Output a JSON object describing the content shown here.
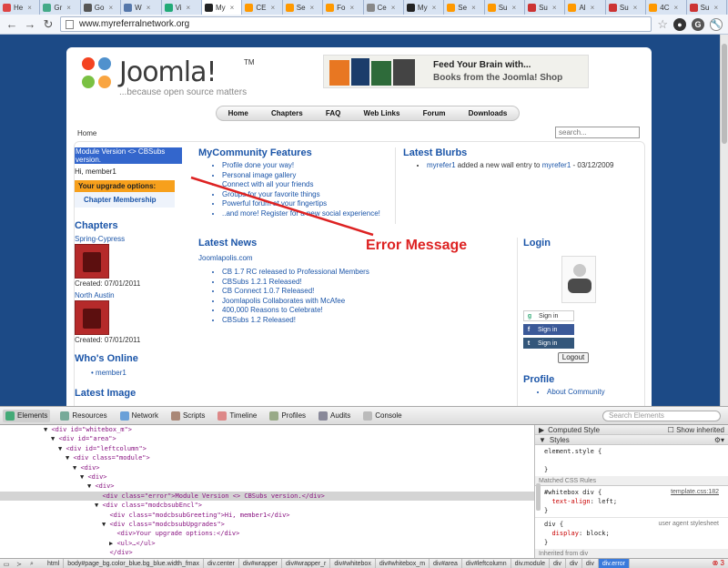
{
  "browser": {
    "tabs": [
      {
        "label": "He",
        "color": "#d44"
      },
      {
        "label": "Gr",
        "color": "#4a8"
      },
      {
        "label": "Go",
        "color": "#555"
      },
      {
        "label": "W",
        "color": "#57a"
      },
      {
        "label": "Vi",
        "color": "#2a7"
      },
      {
        "label": "My",
        "color": "#222",
        "active": true
      },
      {
        "label": "CE",
        "color": "#f90"
      },
      {
        "label": "Se",
        "color": "#f90"
      },
      {
        "label": "Fo",
        "color": "#f90"
      },
      {
        "label": "Ce",
        "color": "#888"
      },
      {
        "label": "My",
        "color": "#222"
      },
      {
        "label": "Se",
        "color": "#f90"
      },
      {
        "label": "Su",
        "color": "#f90"
      },
      {
        "label": "Su",
        "color": "#c33"
      },
      {
        "label": "Al",
        "color": "#f90"
      },
      {
        "label": "Su",
        "color": "#c33"
      },
      {
        "label": "4C",
        "color": "#f90"
      },
      {
        "label": "Su",
        "color": "#c33"
      }
    ],
    "url": "www.myreferralnetwork.org"
  },
  "site": {
    "logo_name": "Joomla!",
    "logo_tm": "TM",
    "logo_tagline": "...because open source matters",
    "banner_line1": "Feed Your Brain with...",
    "banner_line2": "Books from the Joomla! Shop",
    "menu": [
      "Home",
      "Chapters",
      "FAQ",
      "Web Links",
      "Forum",
      "Downloads"
    ],
    "breadcrumb": "Home",
    "search_placeholder": "search...",
    "left": {
      "error": "Module Version <> CBSubs version.",
      "greeting": "Hi, member1",
      "upgrade_header": "Your upgrade options:",
      "upgrade_item": "Chapter Membership",
      "chapters_title": "Chapters",
      "chapters": [
        {
          "name": "Spring-Cypress",
          "created": "Created: 07/01/2011"
        },
        {
          "name": "North Austin",
          "created": "Created: 07/01/2011"
        }
      ],
      "online_title": "Who's Online",
      "online_users": [
        "member1"
      ],
      "latest_image_title": "Latest Image"
    },
    "features": {
      "title": "MyCommunity Features",
      "items": [
        "Profile done your way!",
        "Personal image gallery",
        "Connect with all your friends",
        "Groups for your favorite things",
        "Powerful forum at your fingertips",
        "..and more! Register for a new social experience!"
      ]
    },
    "blurbs": {
      "title": "Latest Blurbs",
      "user": "myrefer1",
      "text": " added a new wall entry to ",
      "target": "myrefer1",
      "date": " - 03/12/2009"
    },
    "news": {
      "title": "Latest News",
      "source": "Joomlapolis.com",
      "items": [
        "CB 1.7 RC released to Professional Members",
        "CBSubs 1.2.1 Released!",
        "CB Connect 1.0.7 Released!",
        "Joomlapolis Collaborates with McAfee",
        "400,000 Reasons to Celebrate!",
        "CBSubs 1.2 Released!"
      ]
    },
    "login": {
      "title": "Login",
      "google": "Sign in",
      "facebook": "Sign in",
      "twitter": "Sign in",
      "logout": "Logout",
      "profile_title": "Profile",
      "profile_item": "About Community"
    },
    "annotation": "Error Message"
  },
  "devtools": {
    "tabs": [
      "Elements",
      "Resources",
      "Network",
      "Scripts",
      "Timeline",
      "Profiles",
      "Audits",
      "Console"
    ],
    "search_placeholder": "Search Elements",
    "dom_lines": [
      {
        "indent": 6,
        "arrow": "▼",
        "html": "<div id=\"whitebox_m\">"
      },
      {
        "indent": 7,
        "arrow": "▼",
        "html": "<div id=\"area\">"
      },
      {
        "indent": 8,
        "arrow": "▼",
        "html": "<div id=\"leftcolumn\">"
      },
      {
        "indent": 9,
        "arrow": "▼",
        "html": "<div class=\"module\">"
      },
      {
        "indent": 10,
        "arrow": "▼",
        "html": "<div>"
      },
      {
        "indent": 11,
        "arrow": "▼",
        "html": "<div>"
      },
      {
        "indent": 12,
        "arrow": "▼",
        "html": "<div>"
      },
      {
        "indent": 13,
        "arrow": "",
        "html": "<div class=\"error\">Module Version <> CBSubs version.</div>",
        "selected": true
      },
      {
        "indent": 13,
        "arrow": "▼",
        "html": "<div class=\"modcbsubEncl\">"
      },
      {
        "indent": 14,
        "arrow": "",
        "html": "<div class=\"modcbsubGreeting\">Hi, member1</div>"
      },
      {
        "indent": 14,
        "arrow": "▼",
        "html": "<div class=\"modcbsubUpgrades\">"
      },
      {
        "indent": 15,
        "arrow": "",
        "html": "<div>Your upgrade options:</div>"
      },
      {
        "indent": 15,
        "arrow": "▶",
        "html": "<ul>…</ul>"
      },
      {
        "indent": 14,
        "arrow": "",
        "html": "</div>"
      }
    ],
    "side": {
      "computed": "Computed Style",
      "show_inherited": "Show inherited",
      "styles": "Styles",
      "element_style": "element.style {",
      "close_brace": "}",
      "matched": "Matched CSS Rules",
      "rule1_selector": "#whitebox div {",
      "rule1_source": "template.css:182",
      "rule1_prop": "text-align",
      "rule1_value": "left;",
      "rule2_selector": "div {",
      "rule2_source": "user agent stylesheet",
      "rule2_prop": "display",
      "rule2_value": "block;",
      "inherited": "Inherited from div"
    },
    "breadcrumbs": [
      "html",
      "body#page_bg.color_blue.bg_blue.width_fmax",
      "div.center",
      "div#wrapper",
      "div#wrapper_r",
      "div#whitebox",
      "div#whitebox_m",
      "div#area",
      "div#leftcolumn",
      "div.module",
      "div",
      "div",
      "div",
      "div.error"
    ],
    "error_count": "3"
  }
}
